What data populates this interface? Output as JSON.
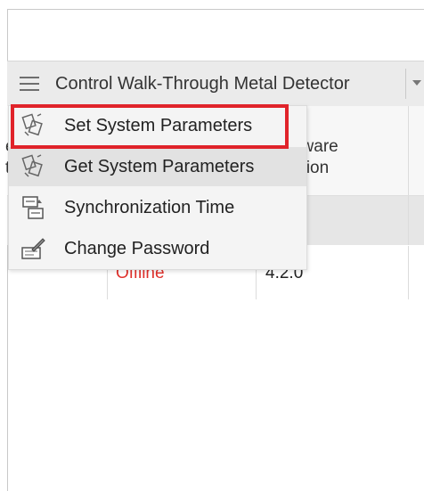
{
  "toolbar": {
    "menu_label": "Control Walk-Through Metal Detector"
  },
  "table": {
    "header_left_fragment_top": "e",
    "header_left_fragment_bottom": "t",
    "header_software": "ftware\nrsion",
    "row2_status": "Offline",
    "row2_version": "4.2.0"
  },
  "dropdown": {
    "items": [
      {
        "label": "Set System Parameters",
        "icon": "params-set-icon"
      },
      {
        "label": "Get System Parameters",
        "icon": "params-get-icon"
      },
      {
        "label": "Synchronization Time",
        "icon": "time-sync-icon"
      },
      {
        "label": "Change Password",
        "icon": "password-edit-icon"
      }
    ]
  },
  "colors": {
    "highlight": "#e0232a",
    "offline": "#e0302b",
    "toolbar_bg": "#ebebeb"
  }
}
